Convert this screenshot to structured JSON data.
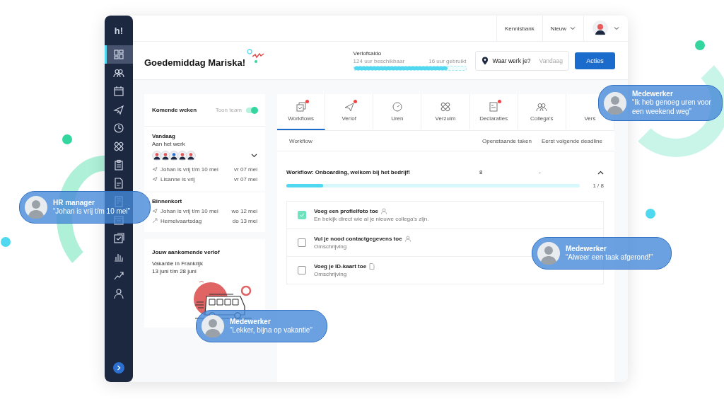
{
  "sidebar": {
    "logo": "h!",
    "items": [
      {
        "kind": "dashboard",
        "selected": true
      },
      {
        "kind": "team",
        "selected": false
      },
      {
        "kind": "calendar",
        "selected": false
      },
      {
        "kind": "plane",
        "selected": false
      },
      {
        "kind": "clock",
        "selected": false
      },
      {
        "kind": "bandage",
        "selected": false
      },
      {
        "kind": "clipboard",
        "selected": false
      },
      {
        "kind": "document",
        "selected": false
      },
      {
        "kind": "receipt",
        "selected": false
      },
      {
        "kind": "folder",
        "selected": false
      },
      {
        "kind": "checklist",
        "selected": false
      },
      {
        "kind": "chart",
        "selected": false
      },
      {
        "kind": "growth",
        "selected": false
      },
      {
        "kind": "person",
        "selected": false
      }
    ]
  },
  "topbar": {
    "links": [
      {
        "label": "Kennisbank",
        "dropdown": false
      },
      {
        "label": "Nieuw",
        "dropdown": true
      }
    ]
  },
  "header": {
    "greeting": "Goedemiddag Mariska!",
    "balance": {
      "title": "Verlofsaldo",
      "available": "124 uur beschikbaar",
      "used": "16 uur gebruikt",
      "level": 0.84
    },
    "location": {
      "label": "Waar werk je?",
      "value": "Vandaag"
    },
    "action": "Acties"
  },
  "upcoming": {
    "title": "Komende weken",
    "toggle_label": "Toon team",
    "toggle_on": true,
    "today": {
      "title": "Vandaag",
      "subtitle": "Aan het werk",
      "events": [
        {
          "kind": "leave",
          "text": "Johan is vrij t/m 10 mei",
          "date": "vr 07 mei"
        },
        {
          "kind": "leave",
          "text": "Lisanne is vrij",
          "date": "vr 07 mei"
        }
      ]
    },
    "soon": {
      "title": "Binnenkort",
      "events": [
        {
          "kind": "leave",
          "text": "Johan is vrij t/m 10 mei",
          "date": "wo 12 mei"
        },
        {
          "kind": "holiday",
          "text": "Hemelvaartsdag",
          "date": "do 13 mei"
        }
      ]
    }
  },
  "leave": {
    "title": "Jouw aankomende verlof",
    "name": "Vakantie in Frankrijk",
    "dates": "13 juni t/m 28 juni"
  },
  "tabs": [
    {
      "label": "Workflows",
      "kind": "workflows",
      "badge": true,
      "selected": true
    },
    {
      "label": "Verlof",
      "kind": "plane",
      "badge": true,
      "selected": false
    },
    {
      "label": "Uren",
      "kind": "clock",
      "badge": false,
      "selected": false
    },
    {
      "label": "Verzuim",
      "kind": "bandage",
      "badge": false,
      "selected": false
    },
    {
      "label": "Declaraties",
      "kind": "receipt",
      "badge": true,
      "selected": false
    },
    {
      "label": "Collega's",
      "kind": "team",
      "badge": false,
      "selected": false
    },
    {
      "label": "Vers",
      "kind": "none",
      "badge": false,
      "selected": false
    }
  ],
  "table": {
    "columns": [
      "Workflow",
      "Openstaande taken",
      "Eerst volgende deadline"
    ],
    "row": {
      "title": "Workflow: Onboarding, welkom bij het bedrijf!",
      "open": "8",
      "deadline": "-",
      "expanded": true,
      "progress": "1 / 8",
      "level": 0.125
    },
    "tasks": [
      {
        "title": "Voeg een profielfoto toe",
        "kind": "person",
        "description": "En bekijk direct wie al je nieuwe collega's zijn.",
        "checked": true
      },
      {
        "title": "Vul je nood contactgegevens toe",
        "kind": "person",
        "description": "Omschrijving",
        "checked": false
      },
      {
        "title": "Voeg je ID-kaart toe",
        "kind": "document",
        "description": "Omschrijving",
        "checked": false
      }
    ]
  },
  "bubbles": [
    {
      "role": "HR manager",
      "quote": "“Johan is vrij t/m 10 mei”"
    },
    {
      "role": "Medewerker",
      "quote": "“Ik heb genoeg uren voor een weekend weg”"
    },
    {
      "role": "Medewerker",
      "quote": "“Alweer een taak afgerond!”"
    },
    {
      "role": "Medewerker",
      "quote": "“Lekker, bijna op vakantie”"
    }
  ]
}
